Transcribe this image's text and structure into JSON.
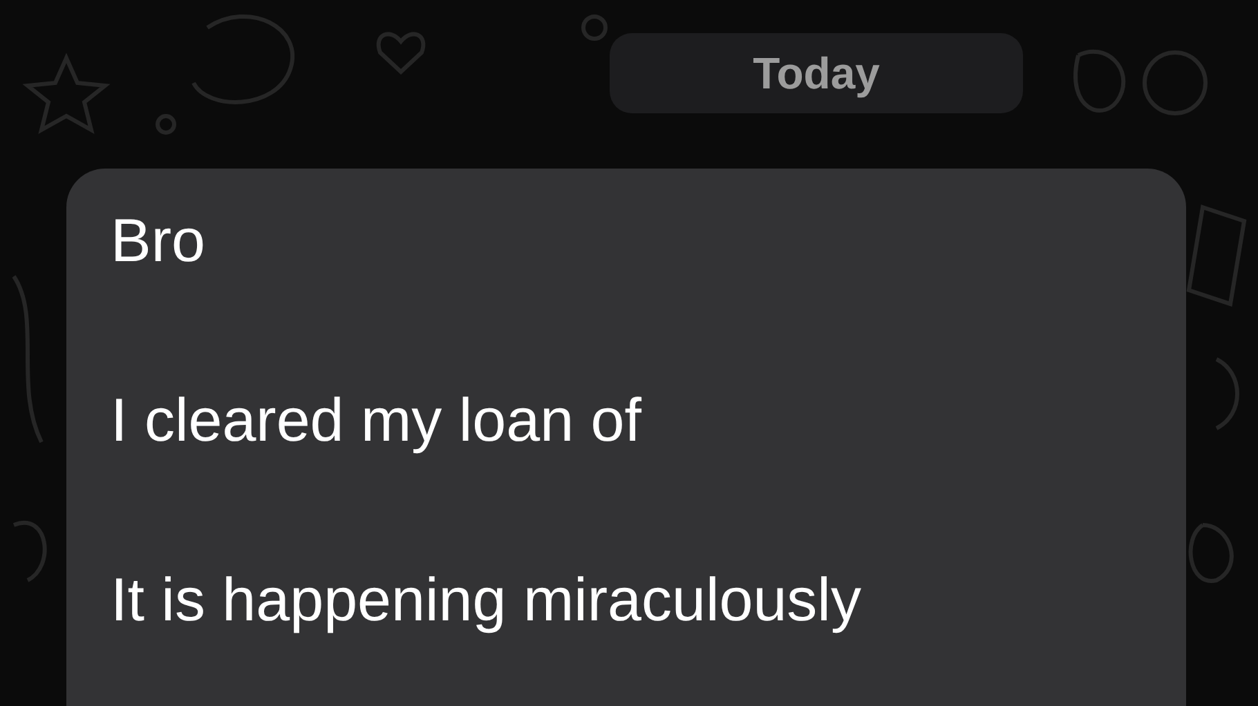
{
  "date_divider": "Today",
  "message": {
    "paragraphs": [
      "Bro",
      "I cleared my loan of",
      "It is happening miraculously"
    ]
  }
}
